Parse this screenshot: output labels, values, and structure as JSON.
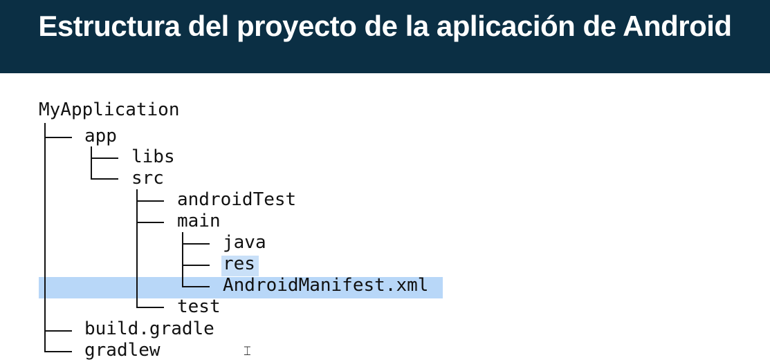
{
  "header": {
    "title": "Estructura del proyecto de la aplicación de Android"
  },
  "tree": {
    "root": "MyApplication",
    "app": "app",
    "libs": "libs",
    "src": "src",
    "androidTest": "androidTest",
    "main": "main",
    "java": "java",
    "res": "res",
    "manifest": "AndroidManifest.xml",
    "test": "test",
    "build_gradle": "build.gradle",
    "gradlew": "gradlew",
    "selected_item": "AndroidManifest.xml"
  },
  "colors": {
    "header_bg": "#0b2f44",
    "selection": "#b8d7f8"
  },
  "icons": {
    "cursor": "text-cursor-icon"
  }
}
